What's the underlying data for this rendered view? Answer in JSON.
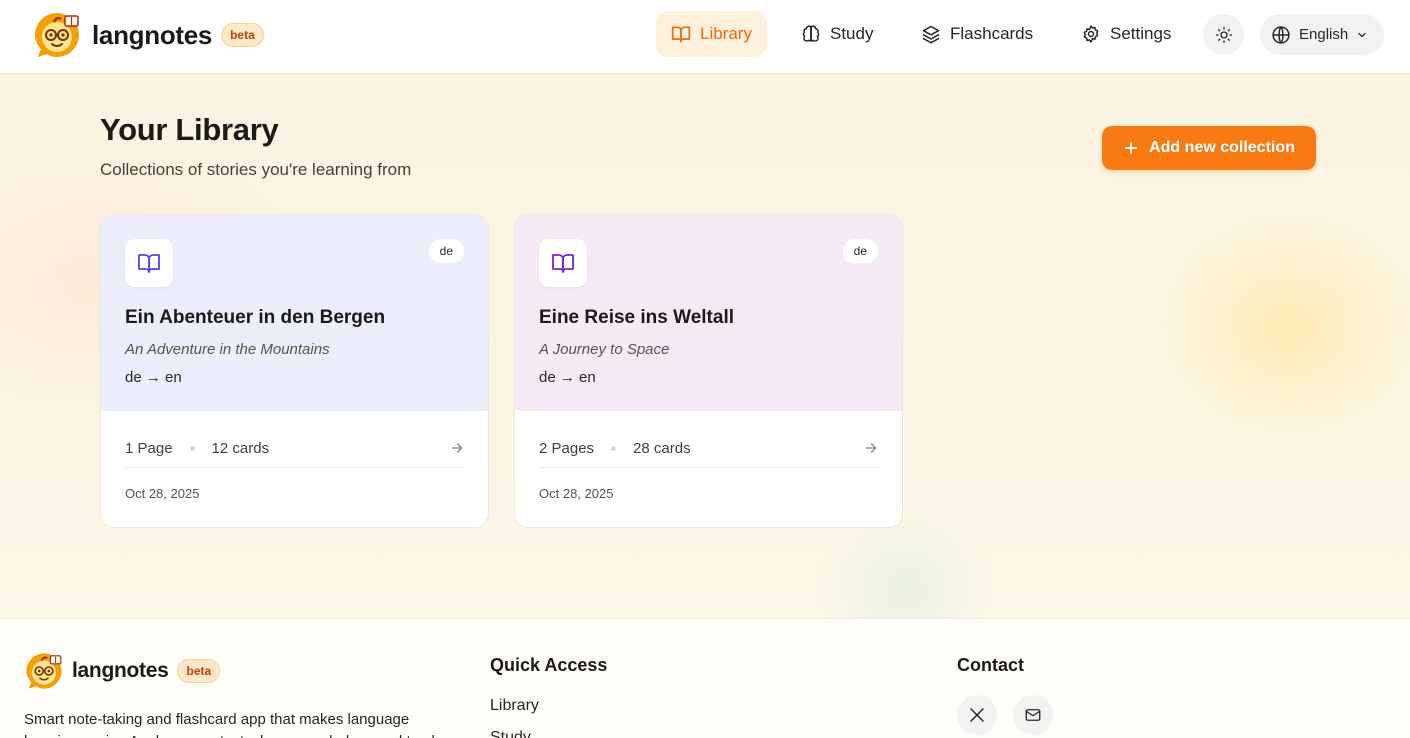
{
  "header": {
    "brand": "langnotes",
    "badge": "beta",
    "nav": [
      {
        "label": "Library",
        "icon": "book-open-icon",
        "active": true
      },
      {
        "label": "Study",
        "icon": "brain-icon",
        "active": false
      },
      {
        "label": "Flashcards",
        "icon": "layers-icon",
        "active": false
      },
      {
        "label": "Settings",
        "icon": "gear-icon",
        "active": false
      }
    ],
    "theme_icon": "sun-icon",
    "language": "English"
  },
  "main": {
    "title": "Your Library",
    "subtitle": "Collections of stories you're learning from",
    "add_button": "Add new collection",
    "collections": [
      {
        "language_badge": "de",
        "title": "Ein Abenteuer in den Bergen",
        "translation": "An Adventure in the Mountains",
        "direction": "de → en",
        "pages": "1 Page",
        "cards": "12 cards",
        "date": "Oct 28, 2025",
        "tint": "#eceefb",
        "icon_color": "#4f46e5"
      },
      {
        "language_badge": "de",
        "title": "Eine Reise ins Weltall",
        "translation": "A Journey to Space",
        "direction": "de → en",
        "pages": "2 Pages",
        "cards": "28 cards",
        "date": "Oct 28, 2025",
        "tint": "#f7eaf7",
        "icon_color": "#7e22ce"
      }
    ]
  },
  "footer": {
    "brand": "langnotes",
    "badge": "beta",
    "description": "Smart note-taking and flashcard app that makes language learning easier. Analyze your texts, learn vocabulary, and track",
    "quick_access_title": "Quick Access",
    "quick_links": [
      "Library",
      "Study"
    ],
    "contact_title": "Contact",
    "contact_icons": [
      "x-twitter-icon",
      "mail-icon"
    ]
  },
  "colors": {
    "accent": "#f77a13",
    "nav_active_bg": "#fdf0dc"
  }
}
